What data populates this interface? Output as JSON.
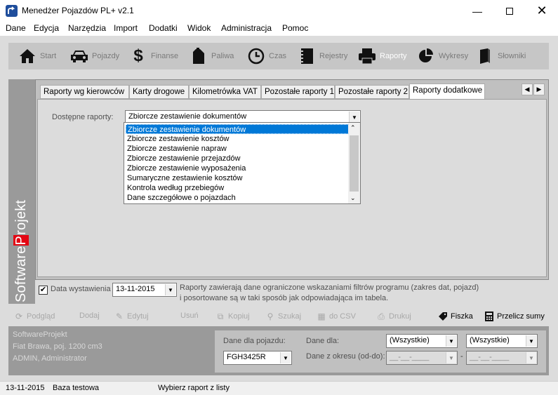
{
  "window": {
    "title": "Menedżer Pojazdów PL+  v2.1"
  },
  "menu": [
    "Dane",
    "Edycja",
    "Narzędzia",
    "Import",
    "Dodatki",
    "Widok",
    "Administracja",
    "Pomoc"
  ],
  "toolbar": [
    {
      "label": "Start",
      "icon": "home-icon"
    },
    {
      "label": "Pojazdy",
      "icon": "car-icon"
    },
    {
      "label": "Finanse",
      "icon": "dollar-icon"
    },
    {
      "label": "Paliwa",
      "icon": "fuel-can-icon"
    },
    {
      "label": "Czas",
      "icon": "clock-icon"
    },
    {
      "label": "Rejestry",
      "icon": "binder-icon"
    },
    {
      "label": "Raporty",
      "icon": "printer-icon"
    },
    {
      "label": "Wykresy",
      "icon": "pie-chart-icon"
    },
    {
      "label": "Słowniki",
      "icon": "book-icon"
    }
  ],
  "brand": {
    "pre": "Software",
    "highlight": "P",
    "post": "rojekt"
  },
  "tabs": [
    "Raporty wg kierowców",
    "Karty drogowe",
    "Kilometrówka VAT",
    "Pozostałe raporty 1",
    "Pozostałe raporty 2",
    "Raporty dodatkowe"
  ],
  "reports": {
    "label": "Dostępne raporty:",
    "selected": "Zbiorcze zestawienie dokumentów",
    "options": [
      "Zbiorcze zestawienie dokumentów",
      "Zbiorcze zestawienie kosztów",
      "Zbiorcze zestawienie napraw",
      "Zbiorcze zestawienie przejazdów",
      "Zbiorcze zestawienie wyposażenia",
      "Sumaryczne zestawienie kosztów",
      "Kontrola według przebiegów",
      "Dane szczegółowe o pojazdach"
    ]
  },
  "issue_date": {
    "label": "Data wystawienia",
    "value": "13-11-2015",
    "checked": true
  },
  "info_text": "Raporty zawierają dane ograniczone wskazaniami filtrów programu (zakres dat, pojazd) i posortowane są w taki sposób jak odpowiadająca im tabela.",
  "actions": [
    {
      "label": "Podgląd",
      "icon": "preview-icon",
      "enabled": false
    },
    {
      "label": "Dodaj",
      "icon": "",
      "enabled": false
    },
    {
      "label": "Edytuj",
      "icon": "pencil-icon",
      "enabled": false
    },
    {
      "label": "Usuń",
      "icon": "",
      "enabled": false
    },
    {
      "label": "Kopiuj",
      "icon": "copy-icon",
      "enabled": false
    },
    {
      "label": "Szukaj",
      "icon": "search-icon",
      "enabled": false
    },
    {
      "label": "do CSV",
      "icon": "csv-icon",
      "enabled": false
    },
    {
      "label": "Drukuj",
      "icon": "print-icon",
      "enabled": false
    },
    {
      "label": "Fiszka",
      "icon": "tag-icon",
      "enabled": true
    },
    {
      "label": "Przelicz sumy",
      "icon": "calculator-icon",
      "enabled": true
    }
  ],
  "info": {
    "company": "SoftwareProjekt",
    "vehicle": "Fiat Brawa, poj. 1200 cm3",
    "user": "ADMIN, Administrator"
  },
  "filters": {
    "vehicle_label": "Dane dla pojazdu:",
    "vehicle_value": "FGH3425R",
    "for_label": "Dane dla:",
    "for_value1": "(Wszystkie)",
    "for_value2": "(Wszystkie)",
    "period_label": "Dane z okresu (od-do):",
    "date_from": "__-__-____",
    "date_sep": "-",
    "date_to": "__-__-____"
  },
  "status": {
    "date": "13-11-2015",
    "db": "Baza testowa",
    "message": "Wybierz raport z listy"
  }
}
